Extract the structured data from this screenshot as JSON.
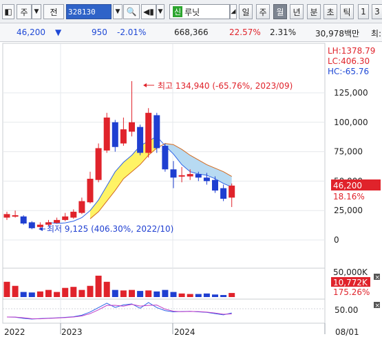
{
  "toolbar": {
    "type_label": "주",
    "jeon_label": "전",
    "code": "328130",
    "stock_name": "루닛",
    "stock_badge": "신",
    "period_tabs": [
      "일",
      "주",
      "월",
      "년"
    ],
    "selected_period": "월",
    "extra_tabs": [
      "분",
      "초",
      "틱"
    ],
    "num_tabs": [
      "1",
      "3"
    ]
  },
  "quote": {
    "price": "46,200",
    "direction": "▼",
    "change": "950",
    "change_pct": "-2.01%",
    "volume": "668,366",
    "vol_ratio": "22.57%",
    "turnover_pct": "2.31%",
    "market_cap": "30,978백만",
    "trailing": "최:"
  },
  "chart_data": {
    "type": "candlestick",
    "x_labels": [
      "2022",
      "2023",
      "2024",
      "08/01"
    ],
    "y_ticks": [
      "125,000",
      "100,000",
      "75,000",
      "50,000",
      "25,000",
      "0"
    ],
    "stats": {
      "lh": "LH:1378.79",
      "lc": "LC:406.30",
      "hc": "HC:-65.76"
    },
    "current_price": "46,200",
    "current_pct": "18.16%",
    "high_annotation": "최고 134,940 (-65.76%, 2023/09)",
    "low_annotation": "최저 9,125 (406.30%, 2022/10)",
    "candles": [
      {
        "o": 19000,
        "c": 22000,
        "h": 24000,
        "l": 17000
      },
      {
        "o": 21000,
        "c": 21000,
        "h": 25000,
        "l": 19000
      },
      {
        "o": 20000,
        "c": 14000,
        "h": 21000,
        "l": 13000
      },
      {
        "o": 15000,
        "c": 10000,
        "h": 16000,
        "l": 9125
      },
      {
        "o": 11000,
        "c": 13000,
        "h": 15000,
        "l": 10000
      },
      {
        "o": 13000,
        "c": 15000,
        "h": 17000,
        "l": 12000
      },
      {
        "o": 14500,
        "c": 17000,
        "h": 19000,
        "l": 14000
      },
      {
        "o": 17000,
        "c": 20000,
        "h": 23000,
        "l": 16000
      },
      {
        "o": 19000,
        "c": 24000,
        "h": 26000,
        "l": 18000
      },
      {
        "o": 23000,
        "c": 33000,
        "h": 36000,
        "l": 22000
      },
      {
        "o": 32000,
        "c": 52000,
        "h": 58000,
        "l": 31000
      },
      {
        "o": 51000,
        "c": 78000,
        "h": 82000,
        "l": 49000
      },
      {
        "o": 76000,
        "c": 104000,
        "h": 108000,
        "l": 74000
      },
      {
        "o": 100000,
        "c": 79000,
        "h": 102000,
        "l": 75000
      },
      {
        "o": 82000,
        "c": 94000,
        "h": 104000,
        "l": 80000
      },
      {
        "o": 92000,
        "c": 100000,
        "h": 134940,
        "l": 88000
      },
      {
        "o": 96000,
        "c": 74000,
        "h": 98000,
        "l": 72000
      },
      {
        "o": 74000,
        "c": 108000,
        "h": 112000,
        "l": 70000
      },
      {
        "o": 106000,
        "c": 78000,
        "h": 108000,
        "l": 74000
      },
      {
        "o": 80000,
        "c": 60000,
        "h": 82000,
        "l": 58000
      },
      {
        "o": 60000,
        "c": 53000,
        "h": 67000,
        "l": 44000
      },
      {
        "o": 54000,
        "c": 55000,
        "h": 62000,
        "l": 49000
      },
      {
        "o": 54000,
        "c": 56000,
        "h": 60000,
        "l": 51000
      },
      {
        "o": 56000,
        "c": 53000,
        "h": 58000,
        "l": 50000
      },
      {
        "o": 53000,
        "c": 50000,
        "h": 57000,
        "l": 47000
      },
      {
        "o": 51000,
        "c": 42000,
        "h": 54000,
        "l": 40000
      },
      {
        "o": 44000,
        "c": 35000,
        "h": 47000,
        "l": 33000
      },
      {
        "o": 36000,
        "c": 46200,
        "h": 48000,
        "l": 28000
      }
    ],
    "ma_short": [
      null,
      null,
      null,
      null,
      null,
      15000,
      14000,
      14500,
      16000,
      19000,
      25000,
      34000,
      46000,
      58000,
      66000,
      72000,
      80000,
      84000,
      88000,
      80000,
      73000,
      64000,
      58000,
      56000,
      55000,
      52000,
      48000,
      45000
    ],
    "ma_long": [
      null,
      null,
      null,
      null,
      null,
      null,
      null,
      null,
      null,
      null,
      18000,
      24000,
      33000,
      42000,
      52000,
      58000,
      64000,
      72000,
      78000,
      82000,
      81000,
      77000,
      72000,
      68000,
      64000,
      61000,
      58000,
      54000
    ],
    "volume_max_label": "50,000K",
    "volume_current": "10,772K",
    "volume_pct": "175.26%",
    "volumes": [
      30,
      22,
      10,
      9,
      11,
      14,
      10,
      18,
      20,
      14,
      22,
      42,
      30,
      14,
      13,
      14,
      12,
      13,
      11,
      14,
      10,
      7,
      6,
      6,
      7,
      5,
      4,
      8
    ],
    "osc_label": "50.00"
  },
  "colors": {
    "up": "#e0232b",
    "down": "#1f3fd1",
    "ma_short": "#2c63e8",
    "ma_long": "#d2691e",
    "cloud": "#fff14a",
    "cloud_blue": "#aad4f0"
  }
}
